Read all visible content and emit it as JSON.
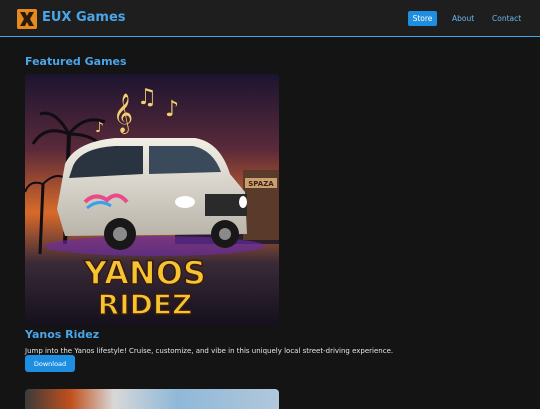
{
  "header": {
    "brand": "EUX Games",
    "nav": {
      "store": "Store",
      "about": "About",
      "contact": "Contact"
    }
  },
  "main": {
    "section_title": "Featured Games",
    "games": [
      {
        "title": "Yanos Ridez",
        "image_text_line1": "YANOS",
        "image_text_line2": "RIDEZ",
        "image_shop_sign": "SPAZA",
        "description": "Jump into the Yanos lifestyle! Cruise, customize, and vibe in this uniquely local street-driving experience.",
        "button": "Download"
      }
    ]
  },
  "colors": {
    "accent": "#4aa6e8",
    "button": "#1e8fe0",
    "background": "#141414",
    "logo": "#e58a1f"
  }
}
